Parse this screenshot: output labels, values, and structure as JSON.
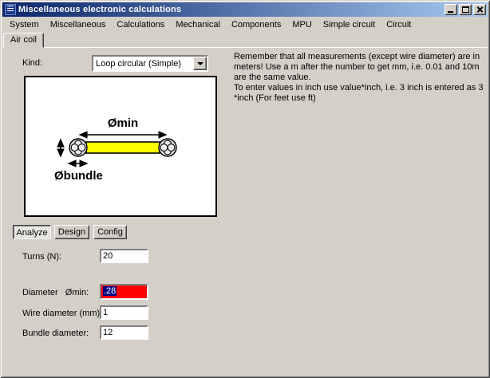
{
  "window": {
    "title": "Miscellaneous electronic calculations",
    "colors": {
      "titlebar_gradient_start": "#0a246a",
      "titlebar_gradient_end": "#a6caf0",
      "button_face": "#d4d0c8",
      "field_highlight_red": "#ff0000",
      "selection_navy": "#000080",
      "coil_yellow": "#ffff00"
    }
  },
  "menu": {
    "items": [
      "System",
      "Miscellaneous",
      "Calculations",
      "Mechanical",
      "Components",
      "MPU",
      "Simple circuit",
      "Circuit"
    ]
  },
  "tab": {
    "label": "Air coil"
  },
  "kind": {
    "label": "Kind:",
    "selected": "Loop circular (Simple)"
  },
  "diagram": {
    "dmin_label": "Ømin",
    "dbundle_label": "Øbundle"
  },
  "note": {
    "para1": "Remember that all measurements (except wire diameter) are in meters! Use a m after the number to get mm, i.e. 0.01 and 10m are the same value.",
    "para2": "To enter values in inch use value*inch, i.e. 3 inch is entered as 3 *inch (For feet use ft)"
  },
  "mode_buttons": {
    "analyze": "Analyze",
    "design": "Design",
    "config": "Config"
  },
  "fields": {
    "turns": {
      "label": "Turns (N):",
      "value": "20"
    },
    "diameter_min": {
      "label": "Diameter   Ømin:",
      "value": ".28"
    },
    "wire_diameter": {
      "label": "Wire diameter (mm):",
      "value": "1"
    },
    "bundle_diameter": {
      "label": "Bundle diameter:",
      "value": "12"
    }
  }
}
